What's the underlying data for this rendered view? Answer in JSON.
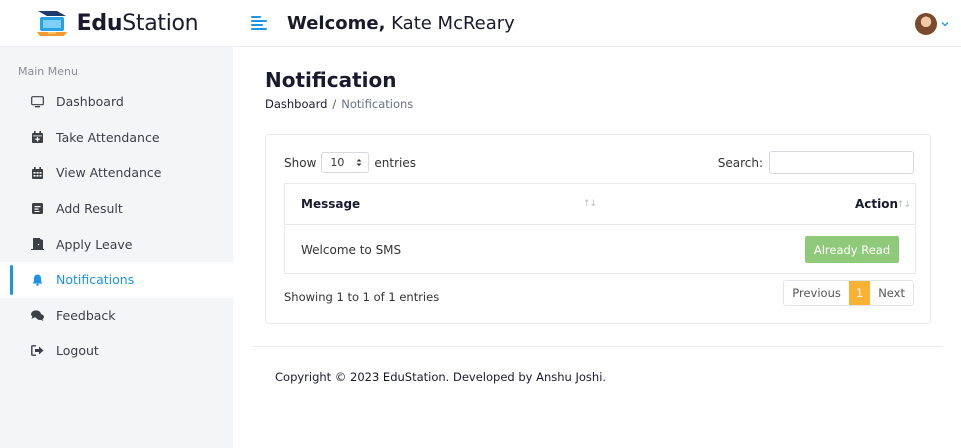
{
  "brand": {
    "bold": "Edu",
    "rest": "Station"
  },
  "topbar": {
    "welcome_bold": "Welcome,",
    "welcome_name": "Kate McReary"
  },
  "sidebar": {
    "menu_title": "Main Menu",
    "items": [
      {
        "label": "Dashboard",
        "icon": "monitor-icon"
      },
      {
        "label": "Take Attendance",
        "icon": "calendar-plus-icon"
      },
      {
        "label": "View Attendance",
        "icon": "calendar-icon"
      },
      {
        "label": "Add Result",
        "icon": "result-icon"
      },
      {
        "label": "Apply Leave",
        "icon": "door-icon"
      },
      {
        "label": "Notifications",
        "icon": "bell-icon",
        "active": true
      },
      {
        "label": "Feedback",
        "icon": "comments-icon"
      },
      {
        "label": "Logout",
        "icon": "sign-out-icon"
      }
    ]
  },
  "page": {
    "title": "Notification",
    "breadcrumb": {
      "home": "Dashboard",
      "sep": "/",
      "current": "Notifications"
    }
  },
  "table_controls": {
    "show_label": "Show",
    "entries_value": "10",
    "entries_label": "entries",
    "search_label": "Search:",
    "search_value": ""
  },
  "table": {
    "columns": [
      "Message",
      "Action"
    ],
    "rows": [
      {
        "message": "Welcome to SMS",
        "action": "Already Read"
      }
    ]
  },
  "pagination": {
    "info": "Showing 1 to 1 of 1 entries",
    "previous": "Previous",
    "current_page": "1",
    "next": "Next"
  },
  "footer": {
    "copyright": "Copyright © 2023 EduStation. Developed by Anshu Joshi."
  },
  "colors": {
    "accent": "#1b94e8",
    "badge": "#8fca7a",
    "page_active": "#fbb131"
  }
}
